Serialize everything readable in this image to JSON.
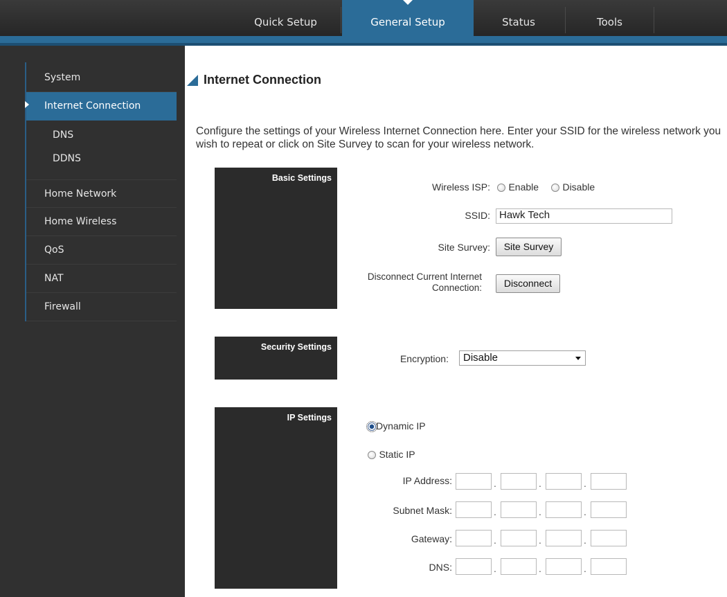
{
  "nav": {
    "tabs": [
      {
        "label": "Quick Setup"
      },
      {
        "label": "General Setup"
      },
      {
        "label": "Status"
      },
      {
        "label": "Tools"
      }
    ],
    "active_tab": "General Setup"
  },
  "sidebar": {
    "items": [
      {
        "label": "System"
      },
      {
        "label": "Internet Connection"
      },
      {
        "label": "DNS"
      },
      {
        "label": "DDNS"
      },
      {
        "label": "Home Network"
      },
      {
        "label": "Home Wireless"
      },
      {
        "label": "QoS"
      },
      {
        "label": "NAT"
      },
      {
        "label": "Firewall"
      }
    ],
    "active_item": "Internet Connection"
  },
  "page": {
    "title": "Internet Connection",
    "description": "Configure the settings of your Wireless Internet Connection here. Enter your SSID for the wireless network you wish to repeat or click on Site Survey to scan for your wireless network."
  },
  "basic": {
    "section_label": "Basic Settings",
    "wireless_isp_label": "Wireless ISP:",
    "enable_label": "Enable",
    "disable_label": "Disable",
    "ssid_label": "SSID:",
    "ssid_value": "Hawk Tech",
    "site_survey_label": "Site Survey:",
    "site_survey_button": "Site Survey",
    "disconnect_label_1": "Disconnect Current Internet",
    "disconnect_label_2": "Connection:",
    "disconnect_button": "Disconnect"
  },
  "security": {
    "section_label": "Security Settings",
    "encryption_label": "Encryption:",
    "encryption_value": "Disable"
  },
  "ip": {
    "section_label": "IP Settings",
    "dynamic_label": "Dynamic IP",
    "static_label": "Static IP",
    "selected": "Dynamic IP",
    "fields": [
      {
        "label": "IP Address:"
      },
      {
        "label": "Subnet Mask:"
      },
      {
        "label": "Gateway:"
      },
      {
        "label": "DNS:"
      }
    ]
  },
  "colors": {
    "accent": "#2b6c98",
    "dark": "#303030",
    "nav": "#2e2e2e"
  }
}
